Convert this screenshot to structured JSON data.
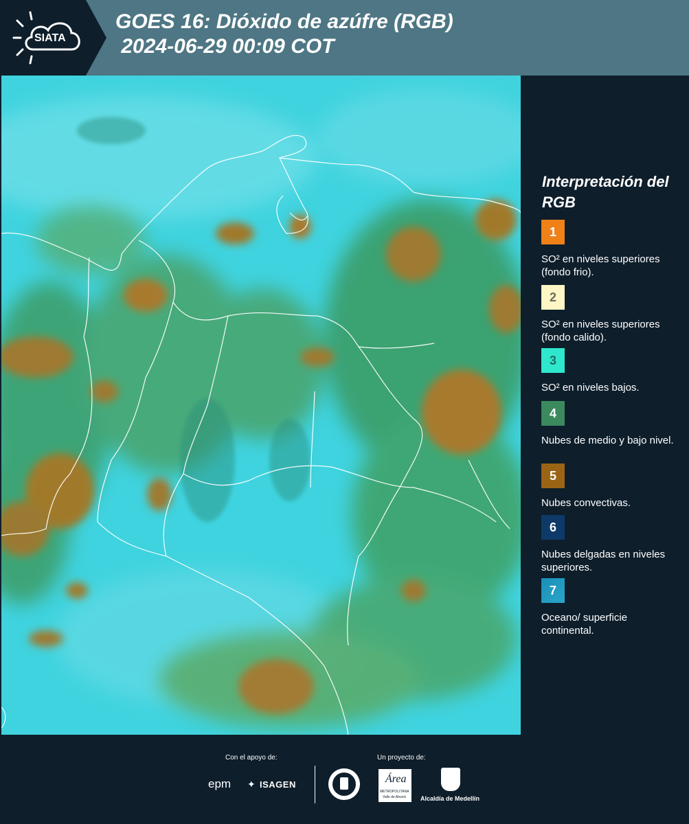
{
  "header": {
    "logo_text": "SIATA",
    "title_line1": "GOES 16: Dióxido de azúfre (RGB)",
    "title_line2": " 2024-06-29 00:09 COT"
  },
  "legend": {
    "title": "Interpretación del RGB",
    "items": [
      {
        "number": "1",
        "color": "#f08119",
        "label": "SO² en niveles superiores (fondo frio)."
      },
      {
        "number": "2",
        "color": "#fef7c5",
        "label": "SO² en niveles superiores (fondo calido)."
      },
      {
        "number": "3",
        "color": "#2fe7cc",
        "label": "SO² en niveles bajos."
      },
      {
        "number": "4",
        "color": "#3a8a5e",
        "label": "Nubes de medio y bajo nivel."
      },
      {
        "number": "5",
        "color": "#9b6415",
        "label": "Nubes convectivas."
      },
      {
        "number": "6",
        "color": "#0e3a6a",
        "label": "Nubes delgadas en niveles superiores."
      },
      {
        "number": "7",
        "color": "#1a8fb8",
        "label": "Oceano/ superficie continental."
      }
    ]
  },
  "footer": {
    "support_label": "Con el apoyo de:",
    "project_label": "Un proyecto de:",
    "epm": "epm",
    "isagen": "ISAGEN",
    "area_metro": "METROPOLITANA",
    "area_metro_sub": "Valle de Aburrá",
    "alcaldia": "Alcaldía de Medellín"
  },
  "colors": {
    "header_bg": "#4e7684",
    "panel_bg": "#0e1e2b",
    "map_cyan": "#39d2de",
    "cloud_green": "#3a9a5a",
    "cloud_brown": "#a67a2a"
  }
}
